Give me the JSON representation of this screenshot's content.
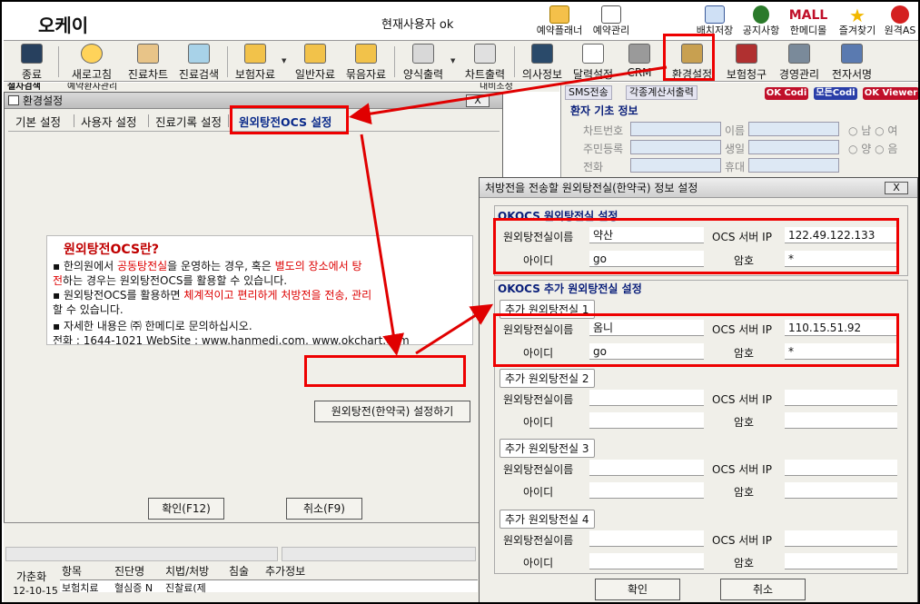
{
  "app": {
    "title": "오케이",
    "current_user": "현재사용자 ok"
  },
  "header_buttons": [
    {
      "label": "예약플래너",
      "icon": "planner-icon"
    },
    {
      "label": "예약관리",
      "icon": "calendar-icon"
    },
    {
      "label": "배치저장",
      "icon": "layout-icon"
    },
    {
      "label": "공지사항",
      "icon": "notice-icon"
    },
    {
      "label": "한메디몰",
      "icon": "mall-icon"
    },
    {
      "label": "즐겨찾기",
      "icon": "star-icon"
    },
    {
      "label": "원격AS",
      "icon": "remote-icon"
    }
  ],
  "header_logo": "MALL",
  "toolbar": [
    {
      "label": "종료",
      "icon": "exit-icon"
    },
    {
      "label": "새로고침",
      "icon": "refresh-icon"
    },
    {
      "label": "진료차트",
      "icon": "chart-icon"
    },
    {
      "label": "진료검색",
      "icon": "search-icon"
    },
    {
      "label": "보험자료",
      "icon": "folder-icon"
    },
    {
      "label": "일반자료",
      "icon": "folder-icon"
    },
    {
      "label": "묶음자료",
      "icon": "folder-icon"
    },
    {
      "label": "양식출력",
      "icon": "printer-icon"
    },
    {
      "label": "차트출력",
      "icon": "chart-print-icon"
    },
    {
      "label": "의사정보",
      "icon": "doctor-icon"
    },
    {
      "label": "달력설정",
      "icon": "calendar-icon"
    },
    {
      "label": "CRM",
      "icon": "crm-icon"
    },
    {
      "label": "환경설정",
      "icon": "settings-icon"
    },
    {
      "label": "보험청구",
      "icon": "claim-icon"
    },
    {
      "label": "경영관리",
      "icon": "management-icon"
    },
    {
      "label": "전자서명",
      "icon": "signature-icon"
    }
  ],
  "background": {
    "left_tab_1": "철자검색",
    "left_tab_2": "예약환자관리",
    "right_tab": "내비조정"
  },
  "config_dialog": {
    "title": "환경설정",
    "close_label": "X",
    "tabs": [
      "기본 설정",
      "사용자 설정",
      "진료기록 설정",
      "원외탕전OCS 설정"
    ],
    "info_title": "원외탕전OCS란?",
    "info_lines": [
      {
        "a": "▪ 한의원에서 ",
        "b": "공동탕전실",
        "c": "을 운영하는 경우, 혹은 ",
        "d": "별도의 장소에서 탕"
      },
      {
        "a": "  ",
        "b": "전",
        "c": "하는 경우는 원외탕전OCS를 활용할 수 있습니다.",
        "d": ""
      },
      {
        "a": "▪ 원외탕전OCS를 활용하면 ",
        "b": "체계적이고 편리하게 처방전을 전송, 관리",
        "c": "",
        "d": ""
      },
      {
        "a": "  할 수 있습니다.",
        "b": "",
        "c": "",
        "d": ""
      },
      {
        "a": "▪ 자세한 내용은 ㈜ 한메디로 문의하십시오.",
        "b": "",
        "c": "",
        "d": ""
      },
      {
        "a": "  전화 : 1644-1021  WebSite : www.hanmedi.com, www.okchart.com",
        "b": "",
        "c": "",
        "d": ""
      }
    ],
    "setup_button": "원외탕전(한약국) 설정하기",
    "ok_button": "확인(F12)",
    "cancel_button": "취소(F9)"
  },
  "patient_panel": {
    "sms": "SMS전송",
    "calc": "각종계산서출력",
    "badges": [
      "OK Codi",
      "모든Codi",
      "OK Viewer"
    ],
    "section_title": "환자 기초 정보",
    "fields": [
      {
        "label": "차트번호",
        "label2": "이름",
        "radio": "○ 남  ○ 여"
      },
      {
        "label": "주민등록",
        "label2": "생일",
        "radio": "○ 양  ○ 음"
      },
      {
        "label": "전화",
        "label2": "휴대",
        "radio": ""
      }
    ],
    "badge_colors": [
      "#c0102a",
      "#2a3ea8",
      "#c0102a"
    ]
  },
  "bottom_grid": {
    "headers": [
      "항목",
      "진단명",
      "치법/처방",
      "침술",
      "추가정보"
    ],
    "left_labels": [
      "가춘화",
      "12-10-15"
    ],
    "rows": [
      "보험치료",
      "혈심증 N",
      "진찰료(제"
    ]
  },
  "ocs_dialog": {
    "title": "처방전을 전송할 원외탕전실(한약국) 정보 설정",
    "close_label": "X",
    "main_section": "OKOCS 원외탕전실 설정",
    "extra_section": "OKOCS 추가 원외탕전실 설정",
    "labels": {
      "room_name": "원외탕전실이름",
      "server_ip": "OCS 서버 IP",
      "user_id": "아이디",
      "password": "암호"
    },
    "main": {
      "room_name": "약산",
      "server_ip": "122.49.122.133",
      "user_id": "go",
      "password": "*"
    },
    "extras": [
      {
        "title": "추가 원외탕전실 1",
        "room_name": "옴니",
        "server_ip": "110.15.51.92",
        "user_id": "go",
        "password": "*"
      },
      {
        "title": "추가 원외탕전실 2",
        "room_name": "",
        "server_ip": "",
        "user_id": "",
        "password": ""
      },
      {
        "title": "추가 원외탕전실 3",
        "room_name": "",
        "server_ip": "",
        "user_id": "",
        "password": ""
      },
      {
        "title": "추가 원외탕전실 4",
        "room_name": "",
        "server_ip": "",
        "user_id": "",
        "password": ""
      }
    ],
    "ok_button": "확인",
    "cancel_button": "취소"
  },
  "colors": {
    "highlight": "#e00000",
    "accent_blue": "#0a1f7a",
    "dialog_bg": "#f0efe9"
  }
}
